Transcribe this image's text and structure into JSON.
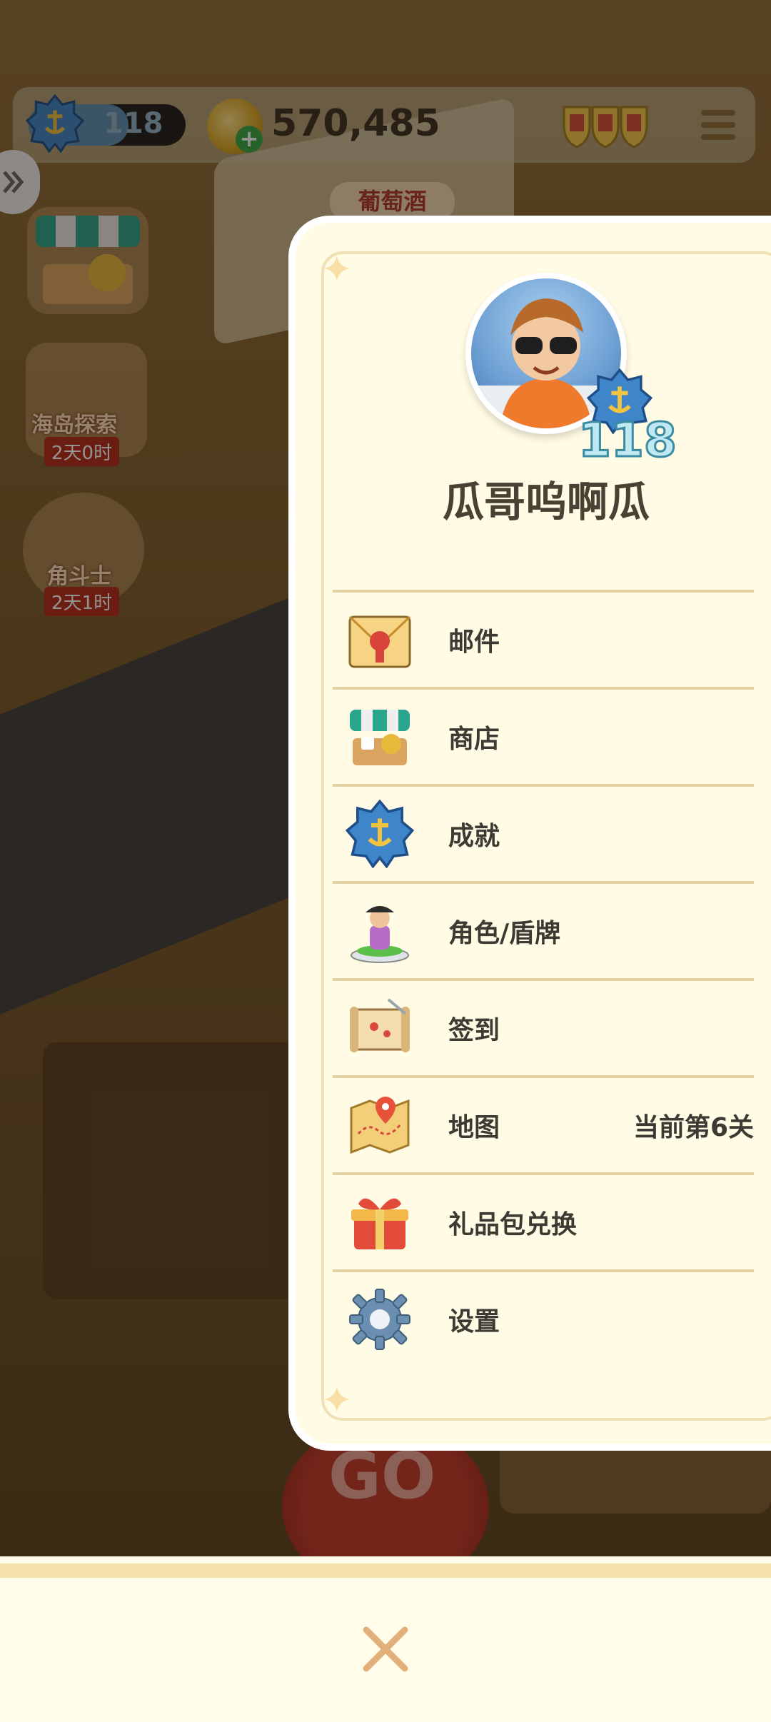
{
  "hud": {
    "level": "118",
    "coins": "570,485"
  },
  "side_events": [
    {
      "label": "海岛探索",
      "sub": "2天0时"
    },
    {
      "label": "角斗士",
      "sub": "2天1时"
    }
  ],
  "board": {
    "tile_label": "葡萄酒",
    "go": "GO"
  },
  "profile": {
    "name": "瓜哥呜啊瓜",
    "level": "118"
  },
  "menu": [
    {
      "label": "邮件",
      "icon": "mail-icon"
    },
    {
      "label": "商店",
      "icon": "shop-icon"
    },
    {
      "label": "成就",
      "icon": "achievement-icon"
    },
    {
      "label": "角色/盾牌",
      "icon": "character-icon"
    },
    {
      "label": "签到",
      "icon": "checkin-scroll-icon"
    },
    {
      "label": "地图",
      "icon": "map-icon",
      "right": "当前第6关"
    },
    {
      "label": "礼品包兑换",
      "icon": "gift-icon"
    },
    {
      "label": "设置",
      "icon": "gear-icon"
    }
  ],
  "colors": {
    "panel_bg": "#fffbe4",
    "divider": "#e4cfa0",
    "text": "#3d3a34",
    "close_x": "#e0b078"
  }
}
